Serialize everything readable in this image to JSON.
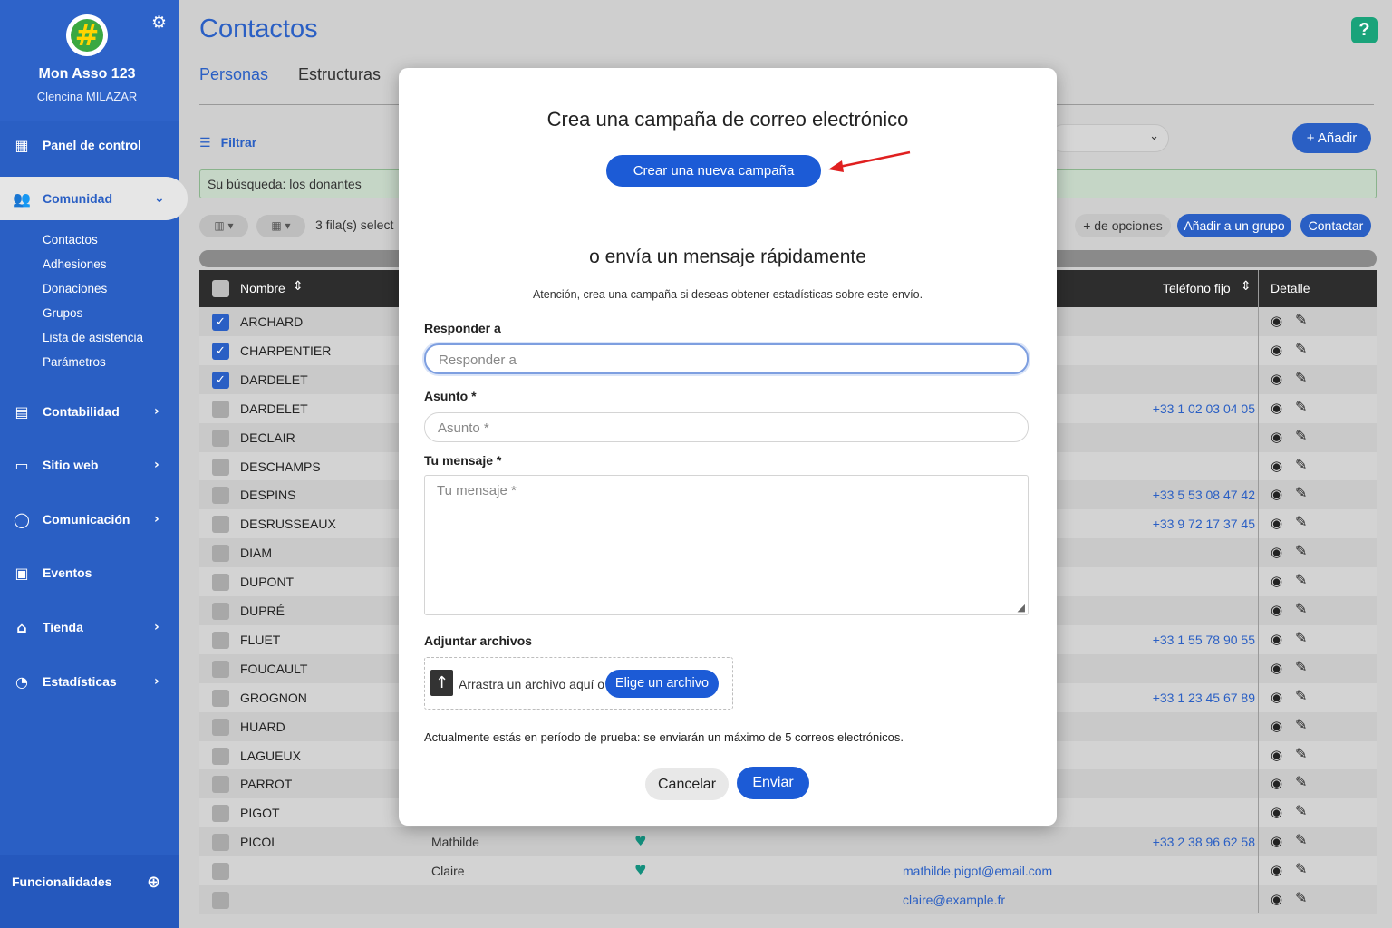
{
  "sidebar": {
    "org_name": "Mon Asso 123",
    "user_name": "Clencina MILAZAR",
    "items": [
      {
        "label": "Panel de control",
        "icon": "dashboard-icon"
      },
      {
        "label": "Comunidad",
        "icon": "users-icon"
      },
      {
        "label": "Contabilidad",
        "icon": "calculator-icon"
      },
      {
        "label": "Sitio web",
        "icon": "laptop-icon"
      },
      {
        "label": "Comunicación",
        "icon": "chat-icon"
      },
      {
        "label": "Eventos",
        "icon": "calendar-icon"
      },
      {
        "label": "Tienda",
        "icon": "store-icon"
      },
      {
        "label": "Estadísticas",
        "icon": "pie-chart-icon"
      }
    ],
    "subitems": [
      "Contactos",
      "Adhesiones",
      "Donaciones",
      "Grupos",
      "Lista de asistencia",
      "Parámetros"
    ],
    "features_label": "Funcionalidades"
  },
  "header": {
    "title": "Contactos",
    "tabs": [
      "Personas",
      "Estructuras"
    ],
    "help": "?"
  },
  "toolbar": {
    "filter_label": "Filtrar",
    "add_label": "+ Añadir",
    "search_text": "Su búsqueda: los donantes",
    "rows_selected": "3 fila(s) select",
    "more_options": "+ de opciones",
    "add_to_group": "Añadir a un grupo",
    "contact": "Contactar"
  },
  "table": {
    "headers": {
      "name": "Nombre",
      "phone": "Teléfono fijo",
      "detail": "Detalle"
    },
    "rows": [
      {
        "name": "ARCHARD",
        "checked": true,
        "firstname": "",
        "email": "",
        "phone": ""
      },
      {
        "name": "CHARPENTIER",
        "checked": true,
        "firstname": "",
        "email": "",
        "phone": ""
      },
      {
        "name": "DARDELET",
        "checked": true,
        "firstname": "",
        "email": "",
        "phone": ""
      },
      {
        "name": "DARDELET",
        "checked": false,
        "firstname": "",
        "email": "",
        "phone": "+33 1 02 03 04 05"
      },
      {
        "name": "DECLAIR",
        "checked": false,
        "firstname": "",
        "email": "",
        "phone": ""
      },
      {
        "name": "DESCHAMPS",
        "checked": false,
        "firstname": "",
        "email": "",
        "phone": ""
      },
      {
        "name": "DESPINS",
        "checked": false,
        "firstname": "",
        "email": "",
        "phone": "+33 5 53 08 47 42"
      },
      {
        "name": "DESRUSSEAUX",
        "checked": false,
        "firstname": "",
        "email": "",
        "phone": "+33 9 72 17 37 45"
      },
      {
        "name": "DIAM",
        "checked": false,
        "firstname": "",
        "email": "",
        "phone": ""
      },
      {
        "name": "DUPONT",
        "checked": false,
        "firstname": "",
        "email": "",
        "phone": ""
      },
      {
        "name": "DUPRÉ",
        "checked": false,
        "firstname": "",
        "email": "",
        "phone": ""
      },
      {
        "name": "FLUET",
        "checked": false,
        "firstname": "",
        "email": "",
        "phone": "+33 1 55 78 90 55"
      },
      {
        "name": "FOUCAULT",
        "checked": false,
        "firstname": "",
        "email": "",
        "phone": ""
      },
      {
        "name": "GROGNON",
        "checked": false,
        "firstname": "",
        "email": "",
        "phone": "+33 1 23 45 67 89"
      },
      {
        "name": "HUARD",
        "checked": false,
        "firstname": "",
        "email": "",
        "phone": ""
      },
      {
        "name": "LAGUEUX",
        "checked": false,
        "firstname": "",
        "email": "",
        "phone": ""
      },
      {
        "name": "PARROT",
        "checked": false,
        "firstname": "",
        "email": "",
        "phone": ""
      },
      {
        "name": "PIGOT",
        "checked": false,
        "firstname": "",
        "email": "",
        "phone": ""
      },
      {
        "name": "PICOL",
        "checked": false,
        "firstname": "Mathilde",
        "email": "",
        "phone": "+33 2 38 96 62 58",
        "heart": true
      },
      {
        "name": "",
        "checked": false,
        "firstname": "Claire",
        "email": "mathilde.pigot@email.com",
        "phone": "",
        "heart": true
      },
      {
        "name": "",
        "checked": false,
        "firstname": "",
        "email": "claire@example.fr",
        "phone": ""
      }
    ]
  },
  "modal": {
    "title": "Crea una campaña de correo electrónico",
    "new_campaign": "Crear una nueva campaña",
    "subtitle": "o envía un mensaje rápidamente",
    "notice": "Atención, crea una campaña si deseas obtener estadísticas sobre este envío.",
    "reply_label": "Responder a",
    "reply_placeholder": "Responder a",
    "subject_label": "Asunto *",
    "subject_placeholder": "Asunto *",
    "message_label": "Tu mensaje *",
    "message_placeholder": "Tu mensaje *",
    "attach_label": "Adjuntar archivos",
    "drop_text": "Arrastra un archivo aquí o",
    "choose_file": "Elige un archivo",
    "trial_note": "Actualmente estás en período de prueba: se enviarán un máximo de 5 correos electrónicos.",
    "cancel": "Cancelar",
    "send": "Enviar"
  },
  "colors": {
    "primary": "#2a5fc4",
    "button": "#1c5bd6",
    "arrow": "#e02020",
    "heart": "#138f7d"
  }
}
